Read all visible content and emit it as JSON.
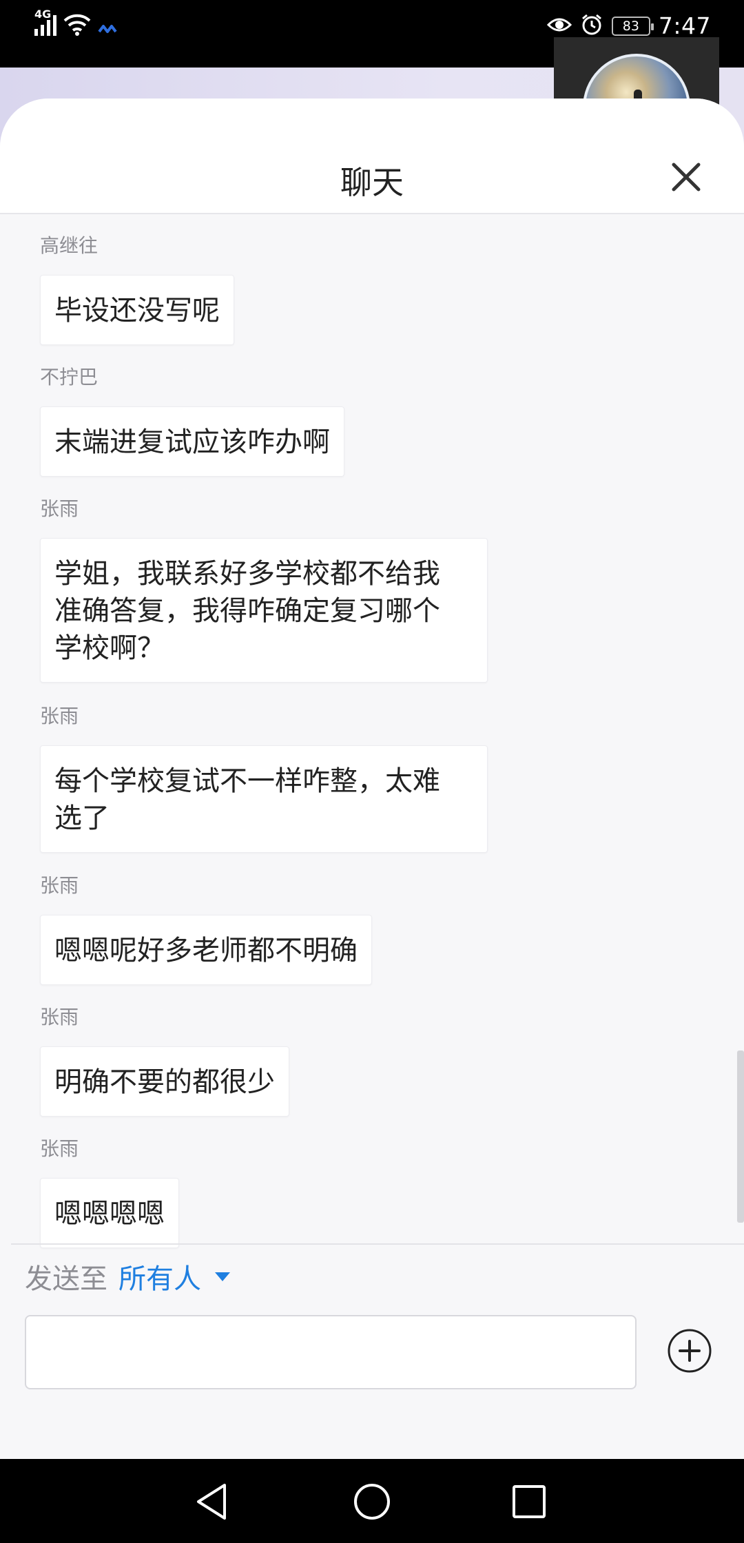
{
  "status_bar": {
    "network_type": "4G",
    "battery_level": "83",
    "time": "7:47",
    "icons": [
      "signal-icon",
      "wifi-icon",
      "data-app-icon",
      "eye-icon",
      "alarm-icon",
      "battery-icon"
    ]
  },
  "chat": {
    "title": "聊天",
    "close_icon": "close-icon",
    "messages": [
      {
        "sender": "高继往",
        "text": "毕设还没写呢"
      },
      {
        "sender": "不拧巴",
        "text": "末端进复试应该咋办啊"
      },
      {
        "sender": "张雨",
        "text": "学姐，我联系好多学校都不给我\n准确答复，我得咋确定复习哪个\n学校啊？"
      },
      {
        "sender": "张雨",
        "text": "每个学校复试不一样咋整，太难\n选了"
      },
      {
        "sender": "张雨",
        "text": "嗯嗯呢好多老师都不明确"
      },
      {
        "sender": "张雨",
        "text": "明确不要的都很少"
      },
      {
        "sender": "张雨",
        "text": "嗯嗯嗯嗯"
      }
    ]
  },
  "composer": {
    "send_to_label": "发送至",
    "recipient": "所有人",
    "input_value": "",
    "add_icon": "plus-circle-icon"
  },
  "nav_bar": {
    "icons": [
      "back-icon",
      "home-icon",
      "recents-icon"
    ]
  },
  "colors": {
    "accent": "#1f7fe0",
    "sheet_bg": "#f7f7f9",
    "bubble_bg": "#ffffff",
    "muted_text": "#8d8d93"
  }
}
